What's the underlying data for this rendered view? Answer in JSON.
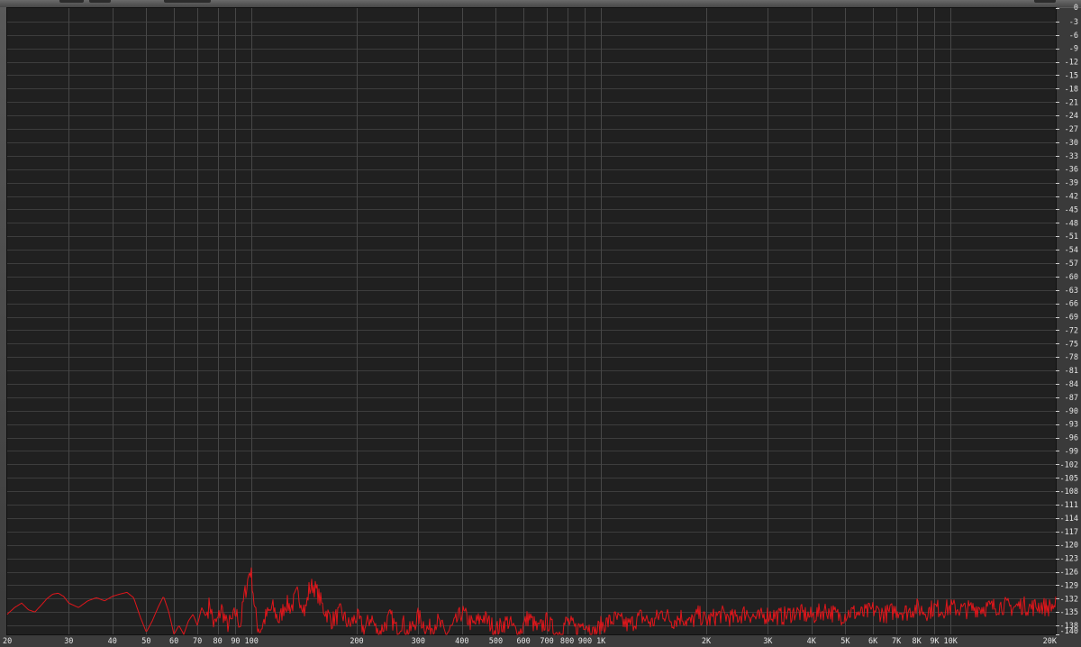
{
  "chart_data": {
    "type": "line",
    "title": "",
    "xlabel": "",
    "ylabel": "",
    "x_scale": "log",
    "xlim": [
      20,
      20000
    ],
    "ylim": [
      -140,
      0
    ],
    "grid": true,
    "x_ticks": [
      {
        "value": 20,
        "label": "20"
      },
      {
        "value": 30,
        "label": "30"
      },
      {
        "value": 40,
        "label": "40"
      },
      {
        "value": 50,
        "label": "50"
      },
      {
        "value": 60,
        "label": "60"
      },
      {
        "value": 70,
        "label": "70"
      },
      {
        "value": 80,
        "label": "80"
      },
      {
        "value": 90,
        "label": "90"
      },
      {
        "value": 100,
        "label": "100"
      },
      {
        "value": 200,
        "label": "200"
      },
      {
        "value": 300,
        "label": "300"
      },
      {
        "value": 400,
        "label": "400"
      },
      {
        "value": 500,
        "label": "500"
      },
      {
        "value": 600,
        "label": "600"
      },
      {
        "value": 700,
        "label": "700"
      },
      {
        "value": 800,
        "label": "800"
      },
      {
        "value": 900,
        "label": "900"
      },
      {
        "value": 1000,
        "label": "1K"
      },
      {
        "value": 2000,
        "label": "2K"
      },
      {
        "value": 3000,
        "label": "3K"
      },
      {
        "value": 4000,
        "label": "4K"
      },
      {
        "value": 5000,
        "label": "5K"
      },
      {
        "value": 6000,
        "label": "6K"
      },
      {
        "value": 7000,
        "label": "7K"
      },
      {
        "value": 8000,
        "label": "8K"
      },
      {
        "value": 9000,
        "label": "9K"
      },
      {
        "value": 10000,
        "label": "10K"
      },
      {
        "value": 20000,
        "label": "20K"
      }
    ],
    "y_ticks": [
      0,
      -3,
      -6,
      -9,
      -12,
      -15,
      -18,
      -21,
      -24,
      -27,
      -30,
      -33,
      -36,
      -39,
      -42,
      -45,
      -48,
      -51,
      -54,
      -57,
      -60,
      -63,
      -66,
      -69,
      -72,
      -75,
      -78,
      -81,
      -84,
      -87,
      -90,
      -93,
      -96,
      -99,
      -102,
      -105,
      -108,
      -111,
      -114,
      -117,
      -120,
      -123,
      -126,
      -129,
      -132,
      -135,
      -138,
      -140
    ],
    "series": [
      {
        "color": "#e0161b",
        "x": [
          20,
          21,
          22,
          23,
          24,
          25,
          26,
          27,
          28,
          29,
          30,
          32,
          34,
          36,
          38,
          40,
          42,
          44,
          46,
          48,
          50,
          52,
          54,
          56,
          58,
          60,
          62,
          64,
          66,
          68,
          70,
          72,
          74,
          76,
          78,
          80,
          82,
          85,
          88,
          90,
          93,
          95,
          97,
          98,
          99,
          100,
          101,
          102,
          104,
          106,
          110,
          115,
          120,
          125,
          130,
          135,
          140,
          142,
          144,
          146,
          150,
          155,
          160,
          170,
          180,
          190,
          200,
          210,
          220,
          230,
          240,
          250,
          260,
          270,
          280,
          290,
          300,
          320,
          340,
          360,
          380,
          400,
          430,
          460,
          500,
          540,
          580,
          620,
          660,
          700,
          750,
          800,
          850,
          900,
          950,
          1000,
          1100,
          1200,
          1300,
          1400,
          1500,
          1600,
          1700,
          1800,
          1900,
          2000,
          2200,
          2400,
          2600,
          2800,
          3000,
          3300,
          3600,
          4000,
          4400,
          4800,
          5200,
          5600,
          6000,
          6500,
          7000,
          7500,
          8000,
          8500,
          9000,
          9500,
          10000,
          11000,
          12000,
          13000,
          14000,
          15000,
          16000,
          17000,
          18000,
          19000,
          20000
        ],
        "y": [
          -135.5,
          -134,
          -133,
          -134.5,
          -135,
          -133.5,
          -132,
          -131,
          -130.8,
          -131.5,
          -133,
          -134,
          -132.5,
          -131.8,
          -132.5,
          -131.5,
          -131,
          -130.6,
          -131.8,
          -136,
          -139.5,
          -137,
          -134,
          -131.5,
          -135,
          -140,
          -138,
          -140,
          -137,
          -135.5,
          -138,
          -134,
          -136,
          -133,
          -138,
          -137,
          -134,
          -138,
          -137,
          -135,
          -138,
          -132,
          -129,
          -127,
          -125.5,
          -127,
          -130,
          -134,
          -138,
          -139,
          -136,
          -134,
          -137,
          -133,
          -134,
          -131,
          -133,
          -135,
          -133,
          -130,
          -129,
          -131,
          -134,
          -137,
          -135,
          -138,
          -136,
          -139,
          -136,
          -140,
          -138,
          -136,
          -139,
          -137,
          -140,
          -138,
          -136,
          -139,
          -137,
          -140,
          -138,
          -135,
          -138,
          -136,
          -139,
          -137,
          -140,
          -136,
          -139,
          -137,
          -140,
          -137,
          -139,
          -137,
          -140,
          -138,
          -136.5,
          -138,
          -136,
          -137.5,
          -135,
          -137,
          -136,
          -137.5,
          -135.5,
          -137,
          -135.5,
          -136.5,
          -135,
          -136.5,
          -135.5,
          -136,
          -135,
          -136,
          -134.5,
          -136,
          -135,
          -135.5,
          -134.5,
          -135.5,
          -134.5,
          -135,
          -134,
          -135,
          -134,
          -134.5,
          -134,
          -134.5,
          -134,
          -134,
          -133.5,
          -134,
          -133.5,
          -134,
          -133.5,
          -134,
          -133.5
        ]
      }
    ]
  }
}
